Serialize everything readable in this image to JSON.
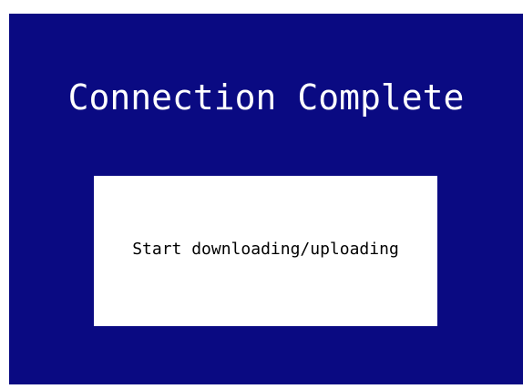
{
  "screen": {
    "title": "Connection Complete",
    "status_message": "Start downloading/uploading"
  },
  "colors": {
    "background": "#0a0a82",
    "title_text": "#ffffff",
    "box_background": "#ffffff",
    "box_text": "#000000"
  }
}
